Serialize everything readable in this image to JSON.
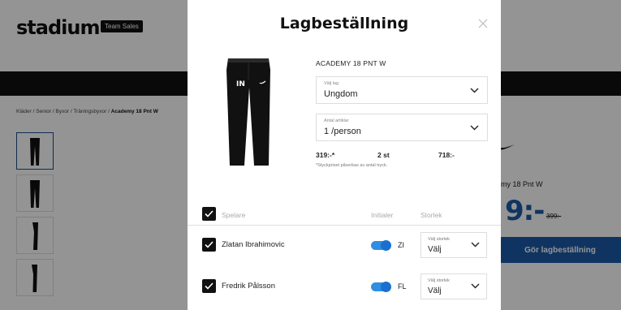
{
  "background": {
    "logo_text": "stadium",
    "logo_badge": "Team Sales",
    "breadcrumb": {
      "path": "Kläder / Senior / Byxor / Träningsbyxor / ",
      "current": "Academy 18 Pnt W"
    },
    "product_title_partial": "my 18 Pnt W",
    "price_partial": "9:-",
    "old_price": "399:-",
    "order_button_label": "Gör lagbeställning",
    "colors": {
      "accent_blue": "#1a5aa8",
      "navbar": "#111111"
    }
  },
  "modal": {
    "title": "Lagbeställning",
    "close_icon": "close-icon",
    "product_name": "ACADEMY 18 PNT W",
    "team_select": {
      "label": "Välj lag",
      "value": "Ungdom"
    },
    "count_select": {
      "label": "Antal artiklar",
      "value": "1 /person"
    },
    "unit_price": "319:-*",
    "quantity": "2 st",
    "total": "718:-",
    "price_note": "*Styckpriset påverkas av antal tryck.",
    "list_header": {
      "player": "Spelare",
      "initials": "Initialer",
      "size": "Storlek"
    },
    "players": [
      {
        "name": "Zlatan Ibrahimovic",
        "initials_enabled": true,
        "initials": "ZI",
        "size_label": "Välj storlek",
        "size_value": "Välj"
      },
      {
        "name": "Fredrik Pålsson",
        "initials_enabled": true,
        "initials": "FL",
        "size_label": "Välj storlek",
        "size_value": "Välj"
      }
    ]
  }
}
